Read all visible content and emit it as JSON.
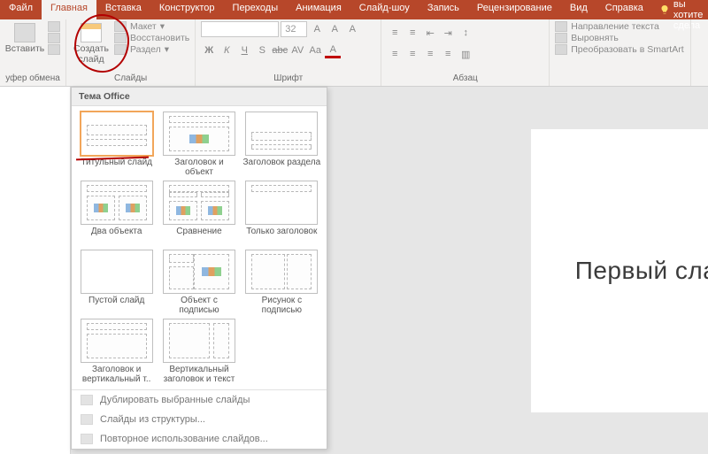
{
  "tabs": {
    "file": "Файл",
    "home": "Главная",
    "insert": "Вставка",
    "design": "Конструктор",
    "transitions": "Переходы",
    "animation": "Анимация",
    "slideshow": "Слайд-шоу",
    "record": "Запись",
    "review": "Рецензирование",
    "view": "Вид",
    "help": "Справка",
    "tellme": "Что вы хотите сдела"
  },
  "groups": {
    "clipboard": {
      "label": "уфер обмена",
      "paste": "Вставить"
    },
    "slides": {
      "label": "Слайды",
      "new_slide": "Создать слайд",
      "layout": "Макет",
      "reset": "Восстановить",
      "section": "Раздел"
    },
    "font": {
      "label": "Шрифт",
      "size": "32",
      "bold": "Ж",
      "italic": "К",
      "underline": "Ч",
      "shadow": "S",
      "strike": "abc",
      "spacing": "AV",
      "case": "Aa"
    },
    "paragraph": {
      "label": "Абзац"
    },
    "text": {
      "direction": "Направление текста",
      "align": "Выровнять",
      "smartart": "Преобразовать в SmartArt"
    }
  },
  "dropdown": {
    "header": "Тема Office",
    "layouts": [
      "Титульный слайд",
      "Заголовок и объект",
      "Заголовок раздела",
      "Два объекта",
      "Сравнение",
      "Только заголовок",
      "Пустой слайд",
      "Объект с подписью",
      "Рисунок с подписью",
      "Заголовок и вертикальный т..",
      "Вертикальный заголовок и текст"
    ],
    "dup": "Дублировать выбранные слайды",
    "outline": "Слайды из структуры...",
    "reuse": "Повторное использование слайдов..."
  },
  "slide": {
    "title": "Первый сла"
  }
}
